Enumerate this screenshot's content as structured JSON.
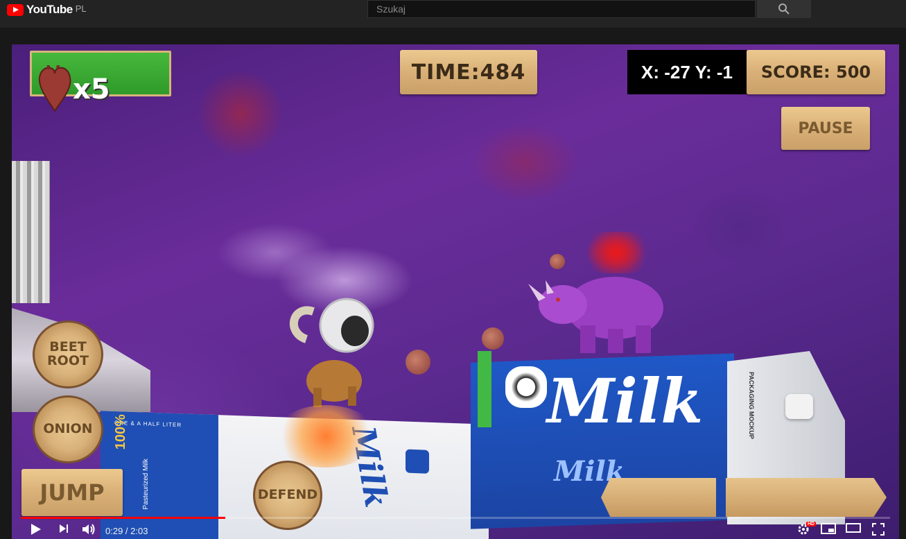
{
  "masthead": {
    "logo_text": "YouTube",
    "country": "PL",
    "search_placeholder": "Szukaj",
    "search_icon": "search-icon"
  },
  "game": {
    "lives": "x5",
    "time": "TIME:484",
    "coords": "X: -27 Y: -1",
    "score": "SCORE: 500",
    "pause_label": "PAUSE",
    "beetroot_label": "BEET ROOT",
    "onion_label": "ONION",
    "jump_label": "JUMP",
    "defend_label": "DEFEND",
    "health_fraction": 1.0
  },
  "scenery": {
    "milk_right_title": "Milk",
    "milk_right_sub": "Milk",
    "milk_right_side": "PACKAGING MOCKUP",
    "milk_left_title": "Milk",
    "milk_left_band": "ONE & A HALF LITER",
    "milk_left_pct": "100%",
    "milk_left_desc": "Pasteurized Milk"
  },
  "player": {
    "time_display": "0:29 / 2:03",
    "progress_fraction": 0.235,
    "icons": [
      "play-icon",
      "next-icon",
      "volume-icon",
      "settings-icon",
      "miniplayer-icon",
      "theater-icon",
      "fullscreen-icon"
    ],
    "hd_badge": "HD",
    "accent": "#ff0000"
  }
}
